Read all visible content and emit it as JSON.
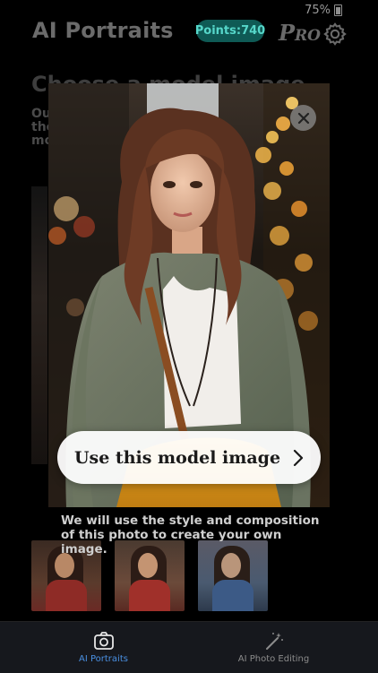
{
  "status_bar": {
    "battery": "75%"
  },
  "header": {
    "title": "AI Portraits",
    "points": "Points:740",
    "pro_first": "P",
    "pro_rest": "RO",
    "settings_icon": "gear-icon"
  },
  "background": {
    "heading": "Choose a model image",
    "description_lines": [
      "Ou",
      "the",
      "mo"
    ]
  },
  "modal": {
    "cta_label": "Use this model image",
    "caption": "We will use the style and composition of this photo to create your own image.",
    "close_icon": "close-icon"
  },
  "thumbnails": [
    {
      "name": "thumbnail-red-dress"
    },
    {
      "name": "thumbnail-red-top"
    },
    {
      "name": "thumbnail-blue-dress"
    }
  ],
  "bottom_nav": {
    "items": [
      {
        "label": "AI Portraits",
        "icon": "camera-icon",
        "active": true
      },
      {
        "label": "AI Photo Editing",
        "icon": "magic-wand-icon",
        "active": false
      }
    ]
  },
  "colors": {
    "accent_teal": "#56d7ca",
    "points_bg": "#0f5a55",
    "nav_active": "#4a90e2",
    "nav_inactive": "#8b8b8b"
  }
}
